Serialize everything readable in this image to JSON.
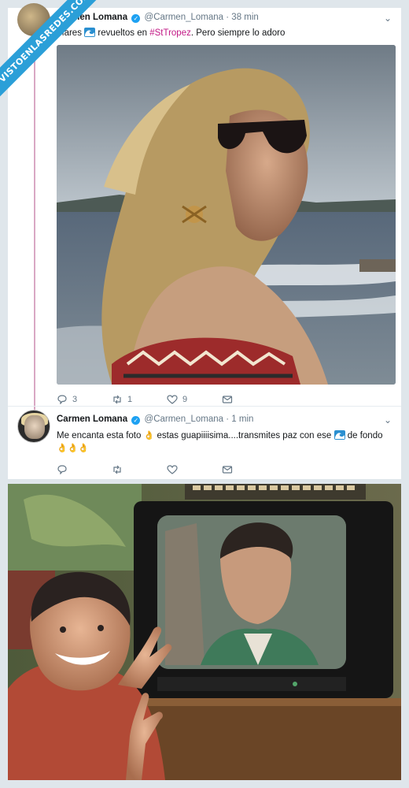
{
  "ribbon": {
    "text": "VISTOENLASREDES.COM"
  },
  "tweet1": {
    "name": "Carmen Lomana",
    "handle": "@Carmen_Lomana",
    "dot": "·",
    "time": "38 min",
    "text_before": "Mares",
    "text_middle": "revueltos en",
    "hashtag": "#StTropez",
    "text_after": ". Pero siempre lo adoro",
    "actions": {
      "replies": "3",
      "retweets": "1",
      "likes": "9"
    }
  },
  "tweet2": {
    "name": "Carmen Lomana",
    "handle": "@Carmen_Lomana",
    "dot": "·",
    "time": "1 min",
    "text_a": "Me encanta esta foto",
    "text_b": "estas guapiiiisima....transmites paz con ese",
    "text_c": "de fondo"
  },
  "colors": {
    "accent": "#1da1f2",
    "hashtag": "#c21885",
    "thread": "#d9a8c4",
    "ribbon": "#2b9fd8"
  }
}
